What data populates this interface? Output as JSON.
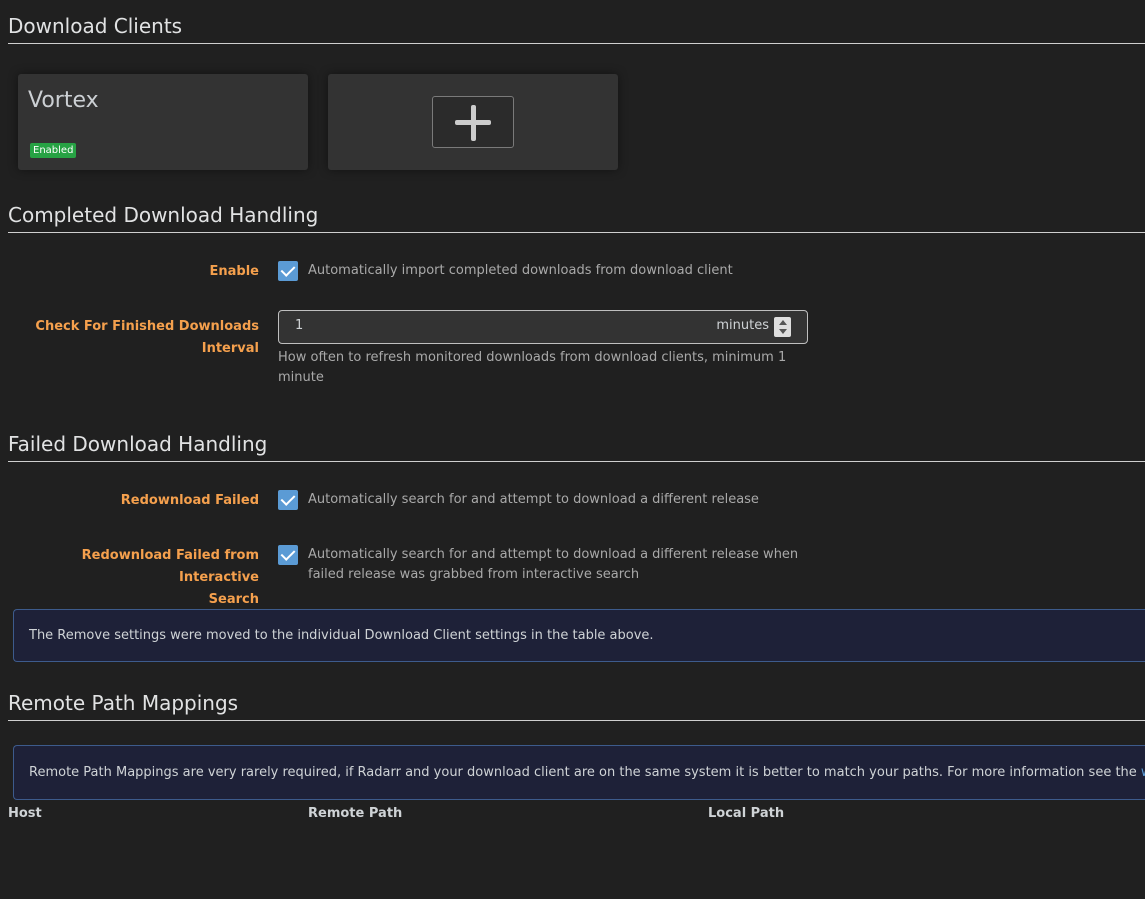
{
  "sections": {
    "download_clients": "Download Clients",
    "completed_handling": "Completed Download Handling",
    "failed_handling": "Failed Download Handling",
    "remote_path_mappings": "Remote Path Mappings"
  },
  "clients": [
    {
      "name": "Vortex",
      "status": "Enabled"
    }
  ],
  "completed": {
    "enable_label": "Enable",
    "enable_checked": true,
    "enable_help": "Automatically import completed downloads from download client",
    "interval_label_line1": "Check For Finished Downloads",
    "interval_label_line2": "Interval",
    "interval_value": "1",
    "interval_unit": "minutes",
    "interval_help_line1": "How often to refresh monitored downloads from download clients, minimum 1",
    "interval_help_line2": "minute"
  },
  "failed": {
    "redownload_label": "Redownload Failed",
    "redownload_checked": true,
    "redownload_help": "Automatically search for and attempt to download a different release",
    "interactive_label_line1": "Redownload Failed from Interactive",
    "interactive_label_line2": "Search",
    "interactive_checked": true,
    "interactive_help_line1": "Automatically search for and attempt to download a different release when",
    "interactive_help_line2": "failed release was grabbed from interactive search"
  },
  "notices": {
    "remove_settings": "The Remove settings were moved to the individual Download Client settings in the table above.",
    "remote_path_text": "Remote Path Mappings are very rarely required, if Radarr and your download client are on the same system it is better to match your paths. For more information see the ",
    "remote_path_link": "wiki",
    "remote_path_end": "."
  },
  "table": {
    "columns": [
      "Host",
      "Remote Path",
      "Local Path"
    ]
  },
  "colors": {
    "accent_label": "#f5a04d",
    "checkbox": "#5b9bd5",
    "badge_enabled": "#27a244",
    "notice_bg": "#1e2138",
    "link": "#5b9bd5"
  }
}
